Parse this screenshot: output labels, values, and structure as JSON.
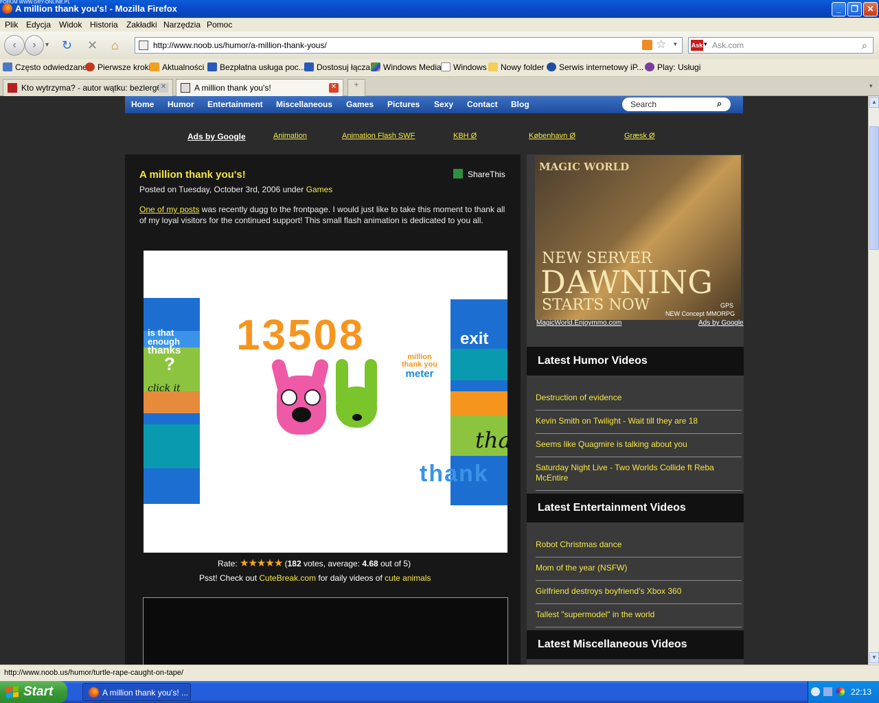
{
  "window": {
    "title": "A million thank you's! - Mozilla Firefox",
    "tiny_overlay": "FORUM WWW.GRY-ONLINE.PL"
  },
  "menu": [
    "Plik",
    "Edycja",
    "Widok",
    "Historia",
    "Zakładki",
    "Narzędzia",
    "Pomoc"
  ],
  "address": {
    "url": "http://www.noob.us/humor/a-million-thank-yous/",
    "search_placeholder": "Ask.com"
  },
  "bookmarks": [
    "Często odwiedzane",
    "Pierwsze kroki",
    "Aktualności",
    "Bezpłatna usługa poc...",
    "Dostosuj łącza",
    "Windows Media",
    "Windows",
    "Nowy folder",
    "Serwis internetowy iP...",
    "Play: Usługi"
  ],
  "tabs": [
    {
      "label": "Kto wytrzyma? - autor wątku: bezlerg6..."
    },
    {
      "label": "A million thank you's!"
    }
  ],
  "site": {
    "nav": [
      "Home",
      "Humor",
      "Entertainment",
      "Miscellaneous",
      "Games",
      "Pictures",
      "Sexy",
      "Contact",
      "Blog"
    ],
    "search_placeholder": "Search",
    "ads": [
      "Ads by Google",
      "Animation",
      "Animation Flash SWF",
      "KBH Ø",
      "København Ø",
      "Græsk Ø"
    ]
  },
  "post": {
    "title": "A million thank you's!",
    "share": "ShareThis",
    "posted_prefix": "Posted on Tuesday, October 3rd, 2006 under ",
    "category": "Games",
    "body_link": "One of my posts",
    "body_text": " was recently dugg to the frontpage. I would just like to take this moment to thank all of my loyal visitors for the continued support! This small flash animation is dedicated to you all."
  },
  "flash": {
    "counter": "13508",
    "meter_text": [
      "million",
      "thank you",
      "meter"
    ],
    "left_text": [
      "is that",
      "enough",
      "thanks"
    ],
    "left_q": "?",
    "left_click": "click it",
    "exit": "exit",
    "tha": "tha",
    "thank": "thank"
  },
  "rating": {
    "rate_label": "Rate:",
    "votes": "182",
    "votes_text": " votes, average: ",
    "average": "4.68",
    "out_of": " out of 5)",
    "open_paren": "(",
    "stars": 4.68
  },
  "psst": {
    "prefix": "Psst! Check out ",
    "link1": "CuteBreak.com",
    "mid": " for daily videos of ",
    "link2": "cute animals"
  },
  "sidebar": {
    "ad_title_1": "NEW SERVER",
    "ad_title_2": "DAWNING",
    "ad_title_3": "STARTS NOW",
    "ad_icons": "NEW Concept MMORPG",
    "ad_gps": "GPS",
    "ad_logo": "MAGIC WORLD",
    "ad_link": "MagicWorld.Enjoymmo.com",
    "ad_by": "Ads by Google",
    "humor_heading": "Latest Humor Videos",
    "humor": [
      "Destruction of evidence",
      "Kevin Smith on Twilight - Wait till they are 18",
      "Seems like Quagmire is talking about you",
      "Saturday Night Live - Two Worlds Collide ft Reba McEntire"
    ],
    "ent_heading": "Latest Entertainment Videos",
    "entertainment": [
      "Robot Christmas dance",
      "Mom of the year (NSFW)",
      "Girlfriend destroys boyfriend's Xbox 360",
      "Tallest \"supermodel\" in the world"
    ],
    "misc_heading": "Latest Miscellaneous Videos"
  },
  "status": "http://www.noob.us/humor/turtle-rape-caught-on-tape/",
  "taskbar": {
    "start": "Start",
    "item": "A million thank you's! ...",
    "clock": "22:13"
  }
}
